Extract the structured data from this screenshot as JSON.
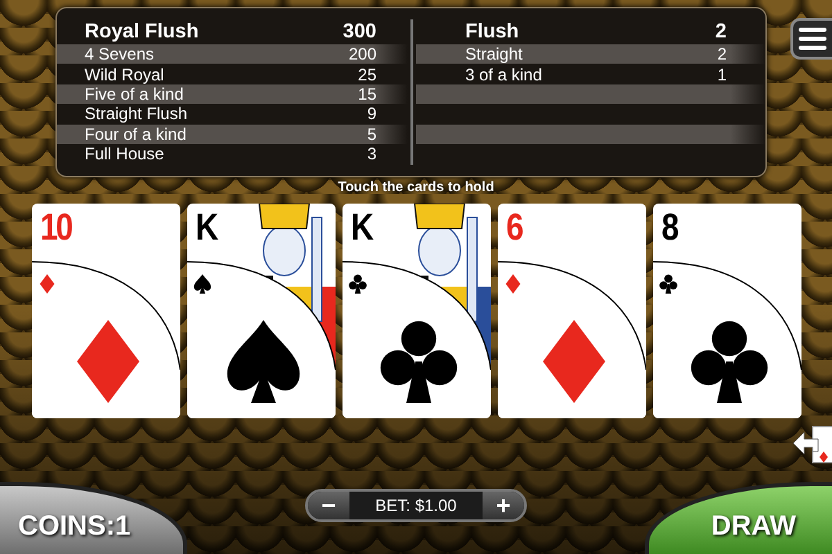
{
  "paytable": {
    "left": [
      {
        "hand": "Royal Flush",
        "payout": "300"
      },
      {
        "hand": "4 Sevens",
        "payout": "200"
      },
      {
        "hand": "Wild Royal",
        "payout": "25"
      },
      {
        "hand": "Five of a kind",
        "payout": "15"
      },
      {
        "hand": "Straight Flush",
        "payout": "9"
      },
      {
        "hand": "Four of a kind",
        "payout": "5"
      },
      {
        "hand": "Full House",
        "payout": "3"
      }
    ],
    "right": [
      {
        "hand": "Flush",
        "payout": "2"
      },
      {
        "hand": "Straight",
        "payout": "2"
      },
      {
        "hand": "3 of a kind",
        "payout": "1"
      }
    ]
  },
  "hint": "Touch the cards to hold",
  "cards": [
    {
      "rank": "10",
      "kind": "diamond",
      "face": false
    },
    {
      "rank": "K",
      "kind": "spade",
      "face": true
    },
    {
      "rank": "K",
      "kind": "club",
      "face": true
    },
    {
      "rank": "6",
      "kind": "diamond",
      "face": false
    },
    {
      "rank": "8",
      "kind": "club",
      "face": false
    }
  ],
  "coins_button": "COINS:1",
  "bet": {
    "minus": "−",
    "label": "BET: $1.00",
    "plus": "+"
  },
  "draw_button": "DRAW"
}
